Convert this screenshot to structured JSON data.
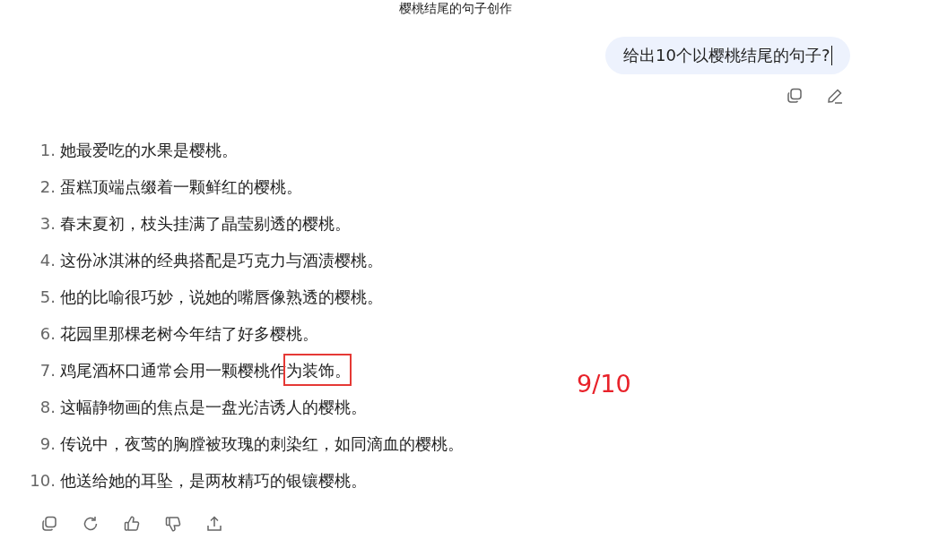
{
  "title": "樱桃结尾的句子创作",
  "user_message": {
    "text": "给出10个以樱桃结尾的句子?",
    "text_cursor": true
  },
  "answer": [
    {
      "number": "1.",
      "text": "她最爱吃的水果是樱桃。"
    },
    {
      "number": "2.",
      "text": "蛋糕顶端点缀着一颗鲜红的樱桃。"
    },
    {
      "number": "3.",
      "text": "春末夏初，枝头挂满了晶莹剔透的樱桃。"
    },
    {
      "number": "4.",
      "text": "这份冰淇淋的经典搭配是巧克力与酒渍樱桃。"
    },
    {
      "number": "5.",
      "text": "他的比喻很巧妙，说她的嘴唇像熟透的樱桃。"
    },
    {
      "number": "6.",
      "text": "花园里那棵老树今年结了好多樱桃。"
    },
    {
      "number": "7.",
      "text": "鸡尾酒杯口通常会用一颗樱桃作为装饰。",
      "marked": true
    },
    {
      "number": "8.",
      "text": "这幅静物画的焦点是一盘光洁诱人的樱桃。"
    },
    {
      "number": "9.",
      "text": "传说中，夜莺的胸膛被玫瑰的刺染红，如同滴血的樱桃。"
    },
    {
      "number": "10.",
      "text": "他送给她的耳坠，是两枚精巧的银镶樱桃。"
    }
  ],
  "annotation": {
    "score": "9/10"
  }
}
